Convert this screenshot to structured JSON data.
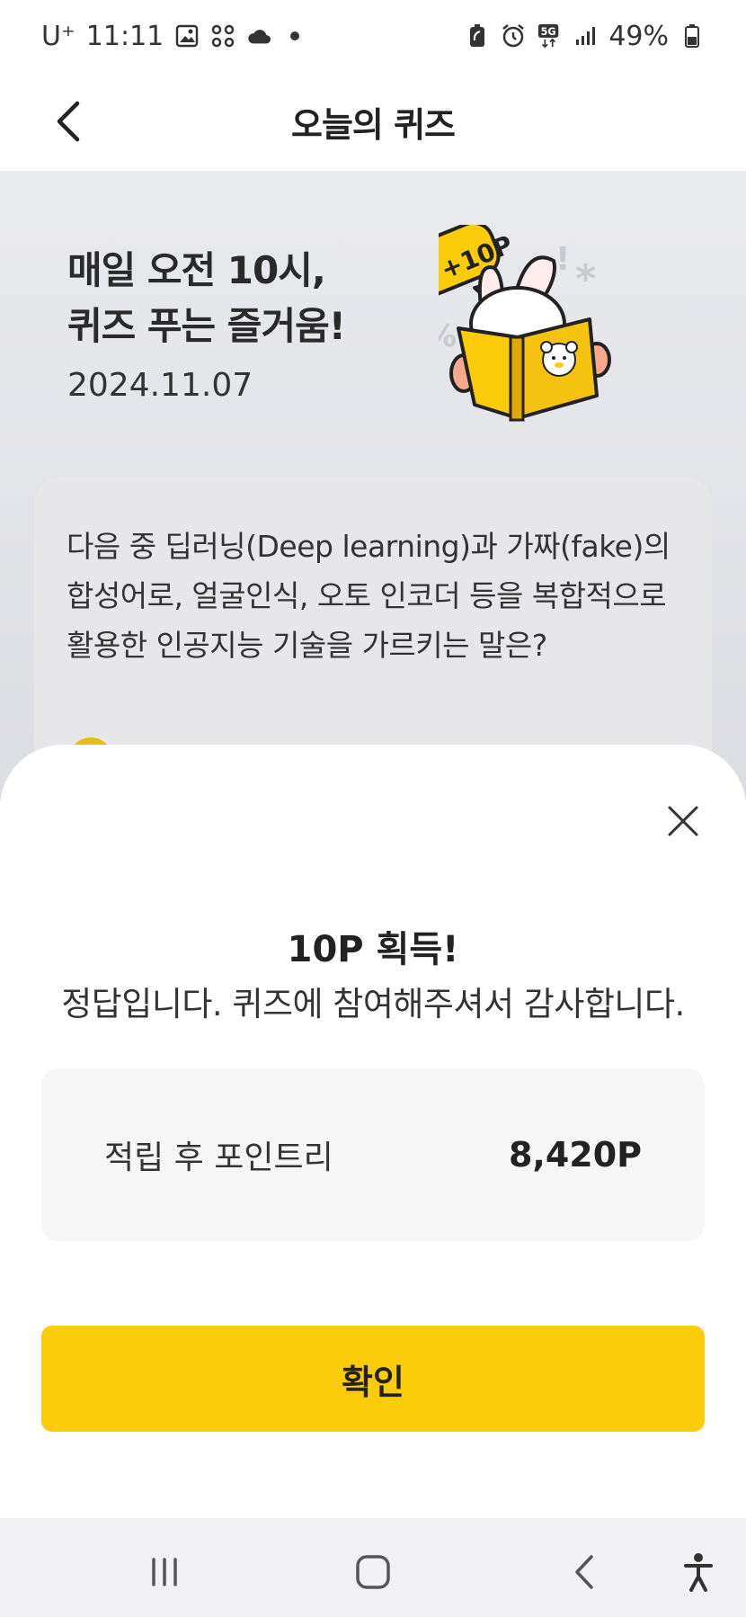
{
  "status_bar": {
    "carrier": "U⁺",
    "time": "11:11",
    "battery": "49%",
    "network": "5G",
    "icons_left": [
      "image-icon",
      "app-grid-icon",
      "cloud-icon",
      "dot-icon"
    ],
    "icons_right": [
      "battery-saver-icon",
      "alarm-icon",
      "network-5g-icon",
      "signal-icon",
      "battery-icon"
    ]
  },
  "header": {
    "title": "오늘의 퀴즈",
    "back_icon": "chevron-left-icon"
  },
  "hero": {
    "headline_line1": "매일 오전 10시,",
    "headline_line2": "퀴즈 푸는 즐거움!",
    "date": "2024.11.07",
    "badge": "+10P"
  },
  "quiz": {
    "question": "다음 중 딥러닝(Deep learning)과 가짜(fake)의 합성어로, 얼굴인식, 오토 인코더 등을 복합적으로 활용한 인공지능 기술을 가르키는 말은?"
  },
  "sheet": {
    "close_icon": "close-icon",
    "title": "10P 획득!",
    "message": "정답입니다. 퀴즈에 참여해주셔서 감사합니다.",
    "points_label": "적립 후 포인트리",
    "points_value": "8,420P",
    "confirm_label": "확인"
  },
  "nav": {
    "recents_icon": "recent-apps-icon",
    "home_icon": "home-icon",
    "back_icon": "back-icon",
    "accessibility_icon": "accessibility-icon"
  },
  "colors": {
    "accent": "#fccc0a",
    "hero_bg": "#e2e3e8",
    "card_bg": "#e7e7ea",
    "points_box_bg": "#f6f6f7"
  }
}
